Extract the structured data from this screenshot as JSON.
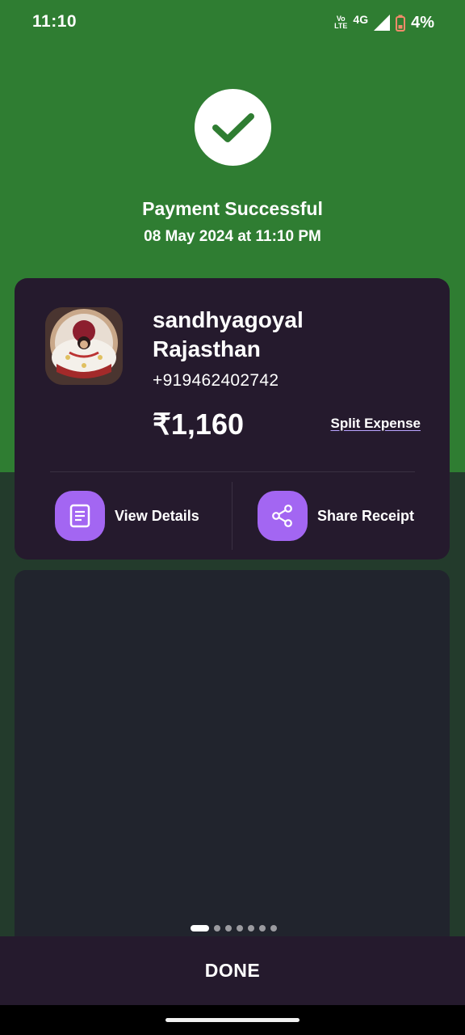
{
  "status_bar": {
    "time": "11:10",
    "volte_top": "Vo",
    "volte_bottom": "LTE",
    "network": "4G",
    "battery_percent": "4%"
  },
  "header": {
    "title": "Payment Successful",
    "datetime": "08 May 2024 at 11:10 PM"
  },
  "payee": {
    "name_line1": "sandhyagoyal",
    "name_line2": "Rajasthan",
    "phone": "+919462402742",
    "amount": "₹1,160",
    "split_label": "Split Expense"
  },
  "actions": {
    "view_details": "View Details",
    "share_receipt": "Share Receipt"
  },
  "carousel": {
    "total_dots": 7,
    "active_index": 0
  },
  "footer": {
    "done_label": "DONE"
  },
  "colors": {
    "success_green": "#2f7d32",
    "card_bg": "#251a2d",
    "accent_purple": "#a366f2"
  }
}
